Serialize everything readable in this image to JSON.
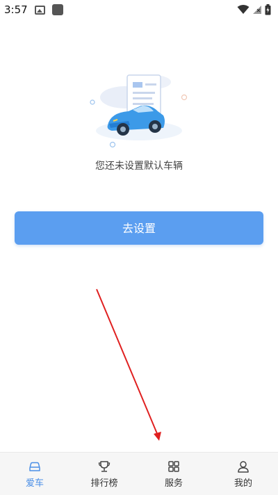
{
  "status_bar": {
    "time": "3:57"
  },
  "main": {
    "empty_message": "您还未设置默认车辆",
    "setup_button_label": "去设置"
  },
  "tabs": [
    {
      "label": "爱车",
      "icon": "car-icon",
      "active": true
    },
    {
      "label": "排行榜",
      "icon": "trophy-icon",
      "active": false
    },
    {
      "label": "服务",
      "icon": "grid-icon",
      "active": false
    },
    {
      "label": "我的",
      "icon": "person-icon",
      "active": false
    }
  ],
  "colors": {
    "primary": "#5b9ef0",
    "active_tab": "#4b8fe6",
    "annotation_arrow": "#e02020"
  }
}
